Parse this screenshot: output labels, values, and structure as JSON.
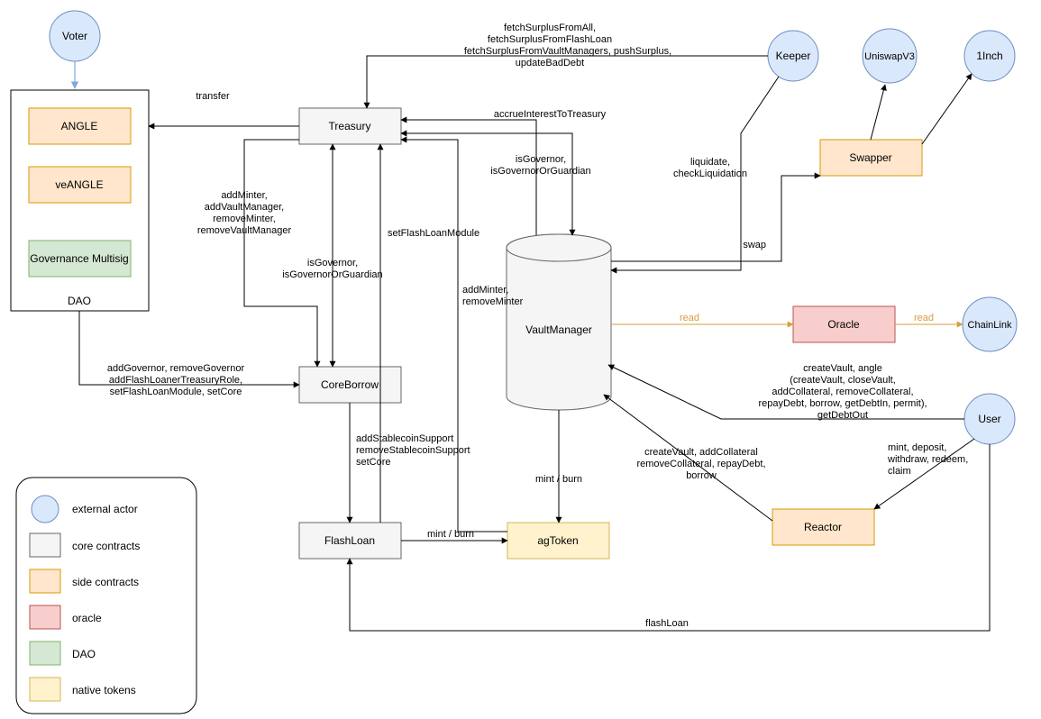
{
  "actors": {
    "voter": "Voter",
    "keeper": "Keeper",
    "uniswap": "UniswapV3",
    "oneinch": "1Inch",
    "chainlink": "ChainLink",
    "user": "User"
  },
  "contracts": {
    "treasury": "Treasury",
    "coreborrow": "CoreBorrow",
    "flashloan": "FlashLoan",
    "vaultmanager": "VaultManager",
    "swapper": "Swapper",
    "oracle": "Oracle",
    "reactor": "Reactor",
    "agtoken": "agToken"
  },
  "dao": {
    "label": "DAO",
    "angle": "ANGLE",
    "veangle": "veANGLE",
    "multisig": "Governance Multisig"
  },
  "edges": {
    "transfer": "transfer",
    "surplus1": "fetchSurplusFromAll,",
    "surplus2": "fetchSurplusFromFlashLoan",
    "surplus3": "fetchSurplusFromVaultManagers, pushSurplus,",
    "surplus4": "updateBadDebt",
    "accrue": "accrueInterestToTreasury",
    "govguard": "isGovernor,\nisGovernorOrGuardian",
    "liquidate": "liquidate,\ncheckLiquidation",
    "swap": "swap",
    "addminter1": "addMinter,\naddVaultManager,\nremoveMinter,\nremoveVaultManager",
    "setflash": "setFlashLoanModule",
    "govguard2": "isGovernor,\nisGovernorOrGuardian",
    "addminter2": "addMinter,\nremoveMinter",
    "read1": "read",
    "read2": "read",
    "addgov": "addGovernor, removeGovernor\naddFlashLoanerTreasuryRole,\nsetFlashLoanModule, setCore",
    "addstable": "addStablecoinSupport\nremoveStablecoinSupport\nsetCore",
    "mintburn1": "mint / burn",
    "mintburn2": "mint / burn",
    "createvault1": "createVault, angle\n(createVault, closeVault,\naddCollateral, removeCollateral,\nrepayDebt, borrow, getDebtIn, permit),\ngetDebtOut",
    "createvault2": "createVault, addCollateral\nremoveCollateral, repayDebt,\nborrow",
    "mintdep": "mint, deposit,\nwithdraw, redeem,\nclaim",
    "flashloan": "flashLoan"
  },
  "legend": {
    "external_actor": "external actor",
    "core_contracts": "core contracts",
    "side_contracts": "side contracts",
    "oracle": "oracle",
    "dao": "DAO",
    "native_tokens": "native tokens"
  }
}
